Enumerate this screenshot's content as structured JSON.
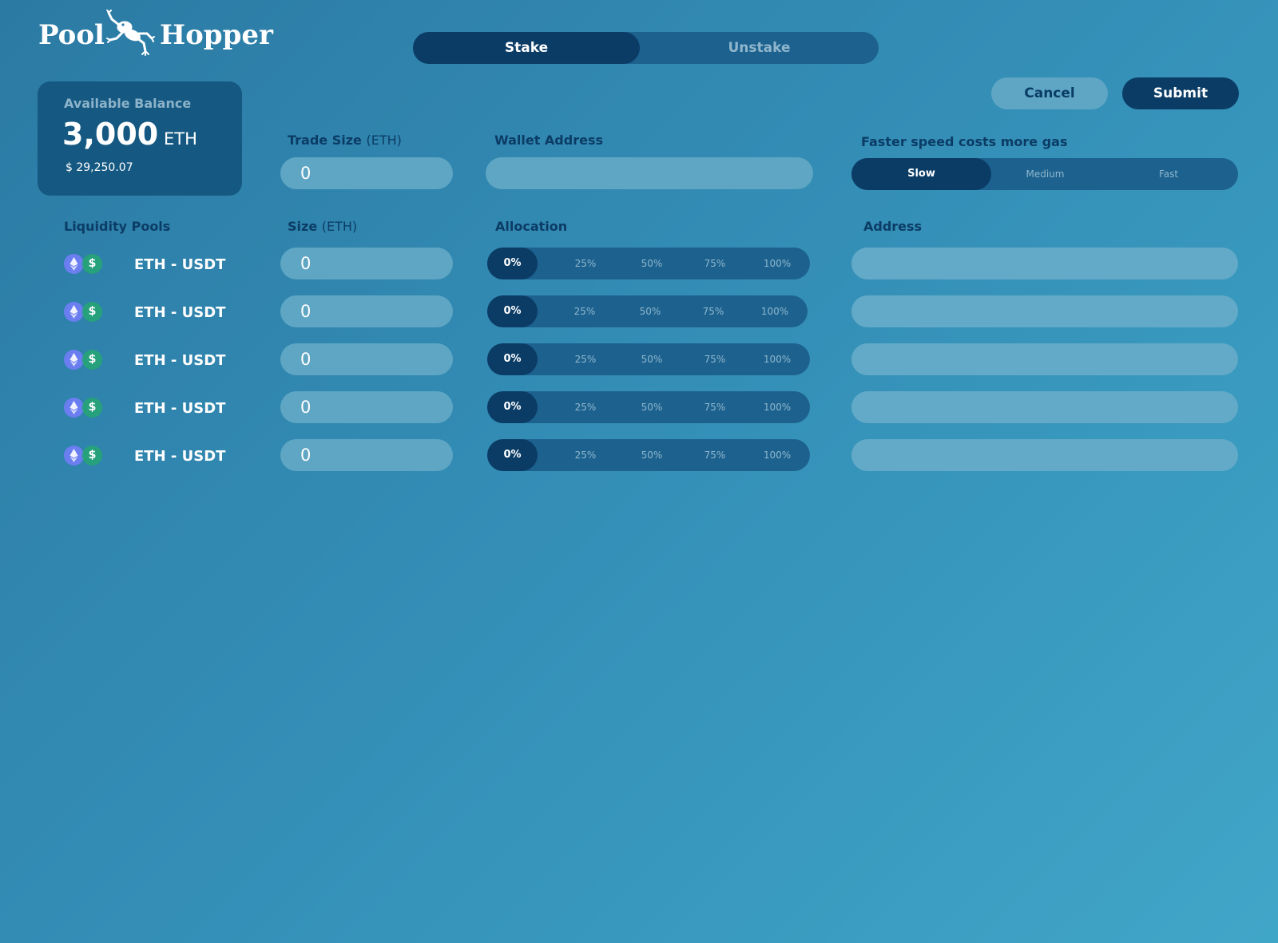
{
  "app": {
    "logo_left": "Pool",
    "logo_right": "Hopper"
  },
  "mode_tabs": [
    {
      "label": "Stake",
      "active": true
    },
    {
      "label": "Unstake",
      "active": false
    }
  ],
  "actions": {
    "cancel_label": "Cancel",
    "submit_label": "Submit"
  },
  "balance": {
    "label": "Available Balance",
    "amount": "3,000",
    "unit": "ETH",
    "usd": "$ 29,250.07"
  },
  "trade_size": {
    "label": "Trade Size",
    "unit": "(ETH)",
    "value": "0"
  },
  "wallet": {
    "label": "Wallet Address",
    "value": ""
  },
  "speed": {
    "label": "Faster speed costs more gas",
    "options": [
      "Slow",
      "Medium",
      "Fast"
    ],
    "selected": "Slow"
  },
  "columns": {
    "pools": "Liquidity Pools",
    "size": "Size",
    "size_unit": "(ETH)",
    "allocation": "Allocation",
    "address": "Address"
  },
  "allocation_options": [
    "0%",
    "25%",
    "50%",
    "75%",
    "100%"
  ],
  "pools": [
    {
      "name": "ETH - USDT",
      "size": "0",
      "allocation": "0%",
      "address": ""
    },
    {
      "name": "ETH - USDT",
      "size": "0",
      "allocation": "0%",
      "address": ""
    },
    {
      "name": "ETH - USDT",
      "size": "0",
      "allocation": "0%",
      "address": ""
    },
    {
      "name": "ETH - USDT",
      "size": "0",
      "allocation": "0%",
      "address": ""
    },
    {
      "name": "ETH - USDT",
      "size": "0",
      "allocation": "0%",
      "address": ""
    }
  ],
  "colors": {
    "accent_dark": "#0b3c66",
    "segment_bg": "#1d628f",
    "input_bg": "#5ea6c4",
    "eth_coin": "#6a7ef0",
    "usdt_coin": "#26a17b"
  },
  "icons": {
    "logo": "frog-icon",
    "eth": "ethereum-icon",
    "usdt": "dollar-icon"
  }
}
